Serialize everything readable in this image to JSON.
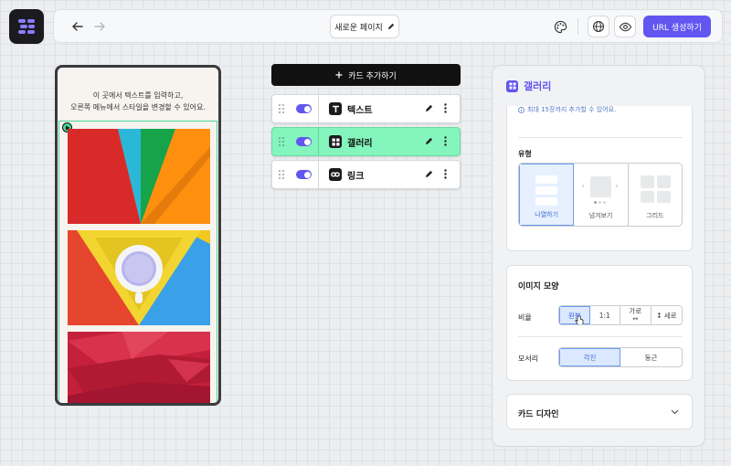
{
  "topbar": {
    "page_name": "새로운 페이지",
    "url_button": "URL 생성하기"
  },
  "phone": {
    "text_line1": "이 곳에서 텍스트를 입력하고,",
    "text_line2": "오른쪽 메뉴에서 스타일을 변경할 수 있어요."
  },
  "cards": {
    "add_label": "카드 추가하기",
    "items": [
      {
        "label": "텍스트",
        "icon": "text-icon",
        "enabled": true,
        "active": false
      },
      {
        "label": "갤러리",
        "icon": "gallery-icon",
        "enabled": true,
        "active": true
      },
      {
        "label": "링크",
        "icon": "link-icon",
        "enabled": true,
        "active": false
      }
    ]
  },
  "panel": {
    "title": "갤러리",
    "note": "최대 15장까지 추가할 수 있어요.",
    "type_label": "유형",
    "type_options": [
      "나열하기",
      "넘겨보기",
      "그리드"
    ],
    "type_selected": "나열하기",
    "image_shape_title": "이미지 모양",
    "ratio_label": "비율",
    "ratio_options": [
      "원본",
      "1:1",
      "가로",
      "세로"
    ],
    "ratio_selected": "원본",
    "corner_label": "모서리",
    "corner_options": [
      "각진",
      "둥근"
    ],
    "corner_selected": "각진",
    "card_design_title": "카드 디자인"
  },
  "colors": {
    "accent": "#6156f0",
    "active_green": "#84f5bd",
    "selection_blue": "#6c9cf0"
  }
}
